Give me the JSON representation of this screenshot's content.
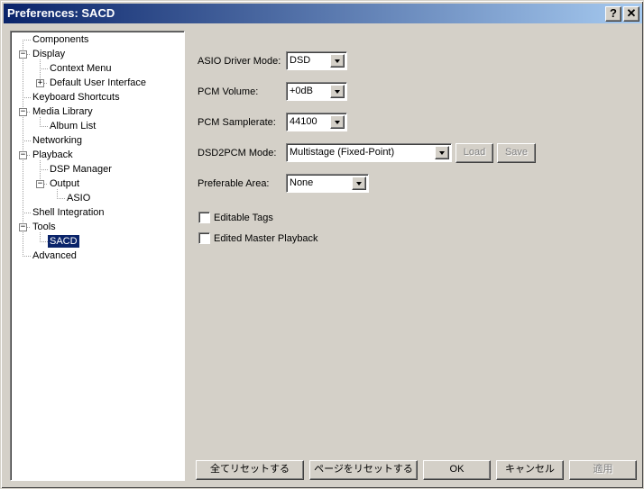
{
  "window": {
    "title": "Preferences: SACD",
    "help_glyph": "?",
    "close_glyph": "✕"
  },
  "tree": {
    "items": [
      {
        "label": "Components"
      },
      {
        "label": "Display"
      },
      {
        "label": "Context Menu"
      },
      {
        "label": "Default User Interface"
      },
      {
        "label": "Keyboard Shortcuts"
      },
      {
        "label": "Media Library"
      },
      {
        "label": "Album List"
      },
      {
        "label": "Networking"
      },
      {
        "label": "Playback"
      },
      {
        "label": "DSP Manager"
      },
      {
        "label": "Output"
      },
      {
        "label": "ASIO"
      },
      {
        "label": "Shell Integration"
      },
      {
        "label": "Tools"
      },
      {
        "label": "SACD"
      },
      {
        "label": "Advanced"
      }
    ],
    "selected": "SACD",
    "expander_minus": "−",
    "expander_plus": "+"
  },
  "form": {
    "asio_driver_mode": {
      "label": "ASIO Driver Mode:",
      "value": "DSD"
    },
    "pcm_volume": {
      "label": "PCM Volume:",
      "value": "+0dB"
    },
    "pcm_samplerate": {
      "label": "PCM Samplerate:",
      "value": "44100"
    },
    "dsd2pcm_mode": {
      "label": "DSD2PCM Mode:",
      "value": "Multistage (Fixed-Point)",
      "load_label": "Load",
      "save_label": "Save"
    },
    "preferable_area": {
      "label": "Preferable Area:",
      "value": "None"
    },
    "editable_tags": {
      "label": "Editable Tags",
      "checked": false
    },
    "edited_master_playback": {
      "label": "Edited Master Playback",
      "checked": false
    }
  },
  "footer": {
    "reset_all": "全てリセットする",
    "reset_page": "ページをリセットする",
    "ok": "OK",
    "cancel": "キャンセル",
    "apply": "適用"
  },
  "icons": [
    "help-icon",
    "close-icon",
    "dropdown-arrow-icon",
    "tree-expander-icon"
  ]
}
